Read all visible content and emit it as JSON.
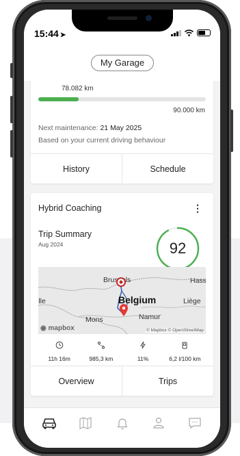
{
  "status_bar": {
    "time": "15:44"
  },
  "header": {
    "garage_button": "My Garage"
  },
  "maintenance_card": {
    "current_km": "78.082 km",
    "max_km": "90.000 km",
    "progress_fraction": 0.24,
    "next_maintenance_label": "Next maintenance: ",
    "next_maintenance_date": "21 May 2025",
    "basis_text": "Based on your current driving behaviour",
    "buttons": {
      "history": "History",
      "schedule": "Schedule"
    }
  },
  "coaching_card": {
    "title": "Hybrid Coaching",
    "trip_summary_title": "Trip Summary",
    "trip_date": "Aug 2024",
    "score": "92",
    "score_fraction": 0.92,
    "accent_color": "#4caf50",
    "map": {
      "labels": {
        "brussels": "Brussels",
        "belgium": "Belgium",
        "liege": "Liège",
        "namur": "Namur",
        "mons": "Mons",
        "lille": "ille",
        "hasselt": "Hasselt"
      },
      "logo": "mapbox",
      "attribution": "© Mapbox © OpenStreetMap"
    },
    "stats": [
      {
        "icon": "clock-icon",
        "value": "11h 16m"
      },
      {
        "icon": "route-icon",
        "value": "985,3 km"
      },
      {
        "icon": "bolt-icon",
        "value": "11%"
      },
      {
        "icon": "fuel-icon",
        "value": "6,2 l/100 km"
      }
    ],
    "buttons": {
      "overview": "Overview",
      "trips": "Trips"
    }
  },
  "bottom_nav": [
    {
      "icon": "car-icon",
      "active": true
    },
    {
      "icon": "map-icon",
      "active": false
    },
    {
      "icon": "bell-icon",
      "active": false
    },
    {
      "icon": "profile-icon",
      "active": false
    },
    {
      "icon": "chat-icon",
      "active": false
    }
  ]
}
